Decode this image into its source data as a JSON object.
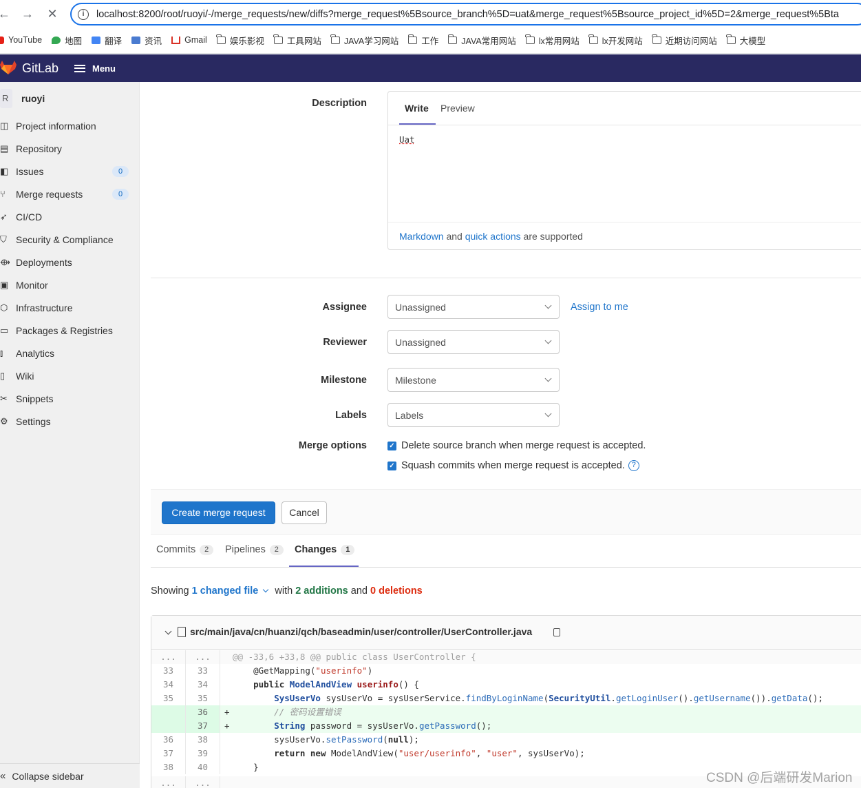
{
  "browser": {
    "back": "←",
    "forward": "→",
    "stop": "✕",
    "url": "localhost:8200/root/ruoyi/-/merge_requests/new/diffs?merge_request%5Bsource_branch%5D=uat&merge_request%5Bsource_project_id%5D=2&merge_request%5Bta",
    "bookmarks": [
      "YouTube",
      "地图",
      "翻译",
      "资讯",
      "Gmail",
      "娱乐影视",
      "工具网站",
      "JAVA学习网站",
      "工作",
      "JAVA常用网站",
      "lx常用网站",
      "lx开发网站",
      "近期访问网站",
      "大模型"
    ]
  },
  "header": {
    "app_name": "GitLab",
    "menu_label": "Menu"
  },
  "sidebar": {
    "project_initial": "R",
    "project_name": "ruoyi",
    "items": [
      {
        "label": "Project information",
        "icon": "info-icon"
      },
      {
        "label": "Repository",
        "icon": "doc-icon"
      },
      {
        "label": "Issues",
        "icon": "issues-icon",
        "badge": "0"
      },
      {
        "label": "Merge requests",
        "icon": "merge-icon",
        "badge": "0"
      },
      {
        "label": "CI/CD",
        "icon": "rocket-icon"
      },
      {
        "label": "Security & Compliance",
        "icon": "shield-icon"
      },
      {
        "label": "Deployments",
        "icon": "deploy-icon"
      },
      {
        "label": "Monitor",
        "icon": "monitor-icon"
      },
      {
        "label": "Infrastructure",
        "icon": "infra-icon"
      },
      {
        "label": "Packages & Registries",
        "icon": "package-icon"
      },
      {
        "label": "Analytics",
        "icon": "chart-icon"
      },
      {
        "label": "Wiki",
        "icon": "book-icon"
      },
      {
        "label": "Snippets",
        "icon": "scissors-icon"
      },
      {
        "label": "Settings",
        "icon": "gear-icon"
      }
    ],
    "collapse_label": "Collapse sidebar"
  },
  "form": {
    "description_label": "Description",
    "tab_write": "Write",
    "tab_preview": "Preview",
    "description_value": "Uat",
    "footer_markdown": "Markdown",
    "footer_and": " and ",
    "footer_quick_actions": "quick actions",
    "footer_supported": " are supported",
    "assignee_label": "Assignee",
    "assignee_value": "Unassigned",
    "assign_to_me": "Assign to me",
    "reviewer_label": "Reviewer",
    "reviewer_value": "Unassigned",
    "milestone_label": "Milestone",
    "milestone_value": "Milestone",
    "labels_label": "Labels",
    "labels_value": "Labels",
    "merge_options_label": "Merge options",
    "option_delete_branch": "Delete source branch when merge request is accepted.",
    "option_squash": "Squash commits when merge request is accepted.",
    "create_button": "Create merge request",
    "cancel_button": "Cancel"
  },
  "mr_tabs": [
    {
      "label": "Commits",
      "count": "2"
    },
    {
      "label": "Pipelines",
      "count": "2"
    },
    {
      "label": "Changes",
      "count": "1"
    }
  ],
  "summary": {
    "showing": "Showing ",
    "changed_files": "1 changed file",
    "with": " with ",
    "additions": "2 additions",
    "and": " and ",
    "deletions": "0 deletions"
  },
  "diff": {
    "file_path": "src/main/java/cn/huanzi/qch/baseadmin/user/controller/UserController.java",
    "hunk_header": "@@ -33,6 +33,8 @@ public class UserController {",
    "ellipsis": "...",
    "lines": [
      {
        "old": "33",
        "new": "33",
        "marker": "",
        "type": "context",
        "code": "    @GetMapping(\"userinfo\")"
      },
      {
        "old": "34",
        "new": "34",
        "marker": "",
        "type": "context",
        "code": "    public ModelAndView userinfo() {"
      },
      {
        "old": "35",
        "new": "35",
        "marker": "",
        "type": "context",
        "code": "        SysUserVo sysUserVo = sysUserService.findByLoginName(SecurityUtil.getLoginUser().getUsername()).getData();"
      },
      {
        "old": "",
        "new": "36",
        "marker": "+",
        "type": "added",
        "code": "        // 密码设置错误"
      },
      {
        "old": "",
        "new": "37",
        "marker": "+",
        "type": "added",
        "code": "        String password = sysUserVo.getPassword();"
      },
      {
        "old": "36",
        "new": "38",
        "marker": "",
        "type": "context",
        "code": "        sysUserVo.setPassword(null);"
      },
      {
        "old": "37",
        "new": "39",
        "marker": "",
        "type": "context",
        "code": "        return new ModelAndView(\"user/userinfo\", \"user\", sysUserVo);"
      },
      {
        "old": "38",
        "new": "40",
        "marker": "",
        "type": "context",
        "code": "    }"
      }
    ]
  },
  "watermark": "CSDN @后端研发Marion",
  "colors": {
    "header_bg": "#292961",
    "primary": "#1f75cb",
    "added_bg": "#ecfdf0"
  }
}
